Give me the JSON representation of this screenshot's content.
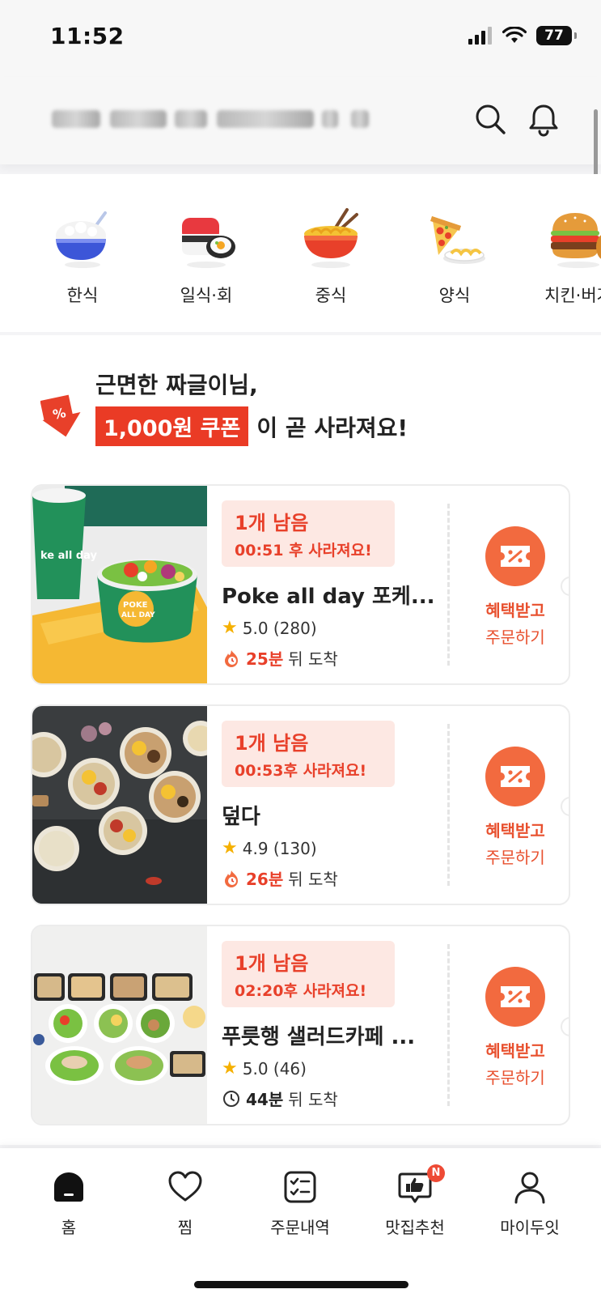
{
  "status_bar": {
    "time": "11:52",
    "battery": "77"
  },
  "categories": [
    {
      "label": "한식",
      "icon": "rice-bowl-icon"
    },
    {
      "label": "일식·회",
      "icon": "sushi-icon"
    },
    {
      "label": "중식",
      "icon": "noodle-bowl-icon"
    },
    {
      "label": "양식",
      "icon": "pizza-pasta-icon"
    },
    {
      "label": "치킨·버거",
      "icon": "burger-chicken-icon"
    }
  ],
  "promo": {
    "title": "근면한 짜글이님,",
    "badge": "1,000원 쿠폰",
    "rest": "이 곧 사라져요!"
  },
  "cards": [
    {
      "remain": "1개 남음",
      "timer": "00:51 후 사라져요!",
      "name": "Poke all day 포케...",
      "rating": "5.0 (280)",
      "eta_min": "25분",
      "eta_rest": "뒤 도착",
      "eta_type": "hot",
      "cta_1": "혜택받고",
      "cta_2": "주문하기"
    },
    {
      "remain": "1개 남음",
      "timer": "00:53후 사라져요!",
      "name": "덮다",
      "rating": "4.9 (130)",
      "eta_min": "26분",
      "eta_rest": "뒤 도착",
      "eta_type": "hot",
      "cta_1": "혜택받고",
      "cta_2": "주문하기"
    },
    {
      "remain": "1개 남음",
      "timer": "02:20후 사라져요!",
      "name": "푸릇행 샐러드카페 ...",
      "rating": "5.0 (46)",
      "eta_min": "44분",
      "eta_rest": "뒤 도착",
      "eta_type": "clock",
      "cta_1": "혜택받고",
      "cta_2": "주문하기"
    }
  ],
  "bottom_nav": [
    {
      "label": "홈",
      "icon": "home-icon"
    },
    {
      "label": "찜",
      "icon": "heart-icon"
    },
    {
      "label": "주문내역",
      "icon": "order-list-icon"
    },
    {
      "label": "맛집추천",
      "icon": "thumbs-up-icon",
      "badge": "N"
    },
    {
      "label": "마이두잇",
      "icon": "person-icon"
    }
  ],
  "colors": {
    "accent": "#e8402a",
    "cta": "#f26a3f",
    "badge": "#ea3b25"
  }
}
